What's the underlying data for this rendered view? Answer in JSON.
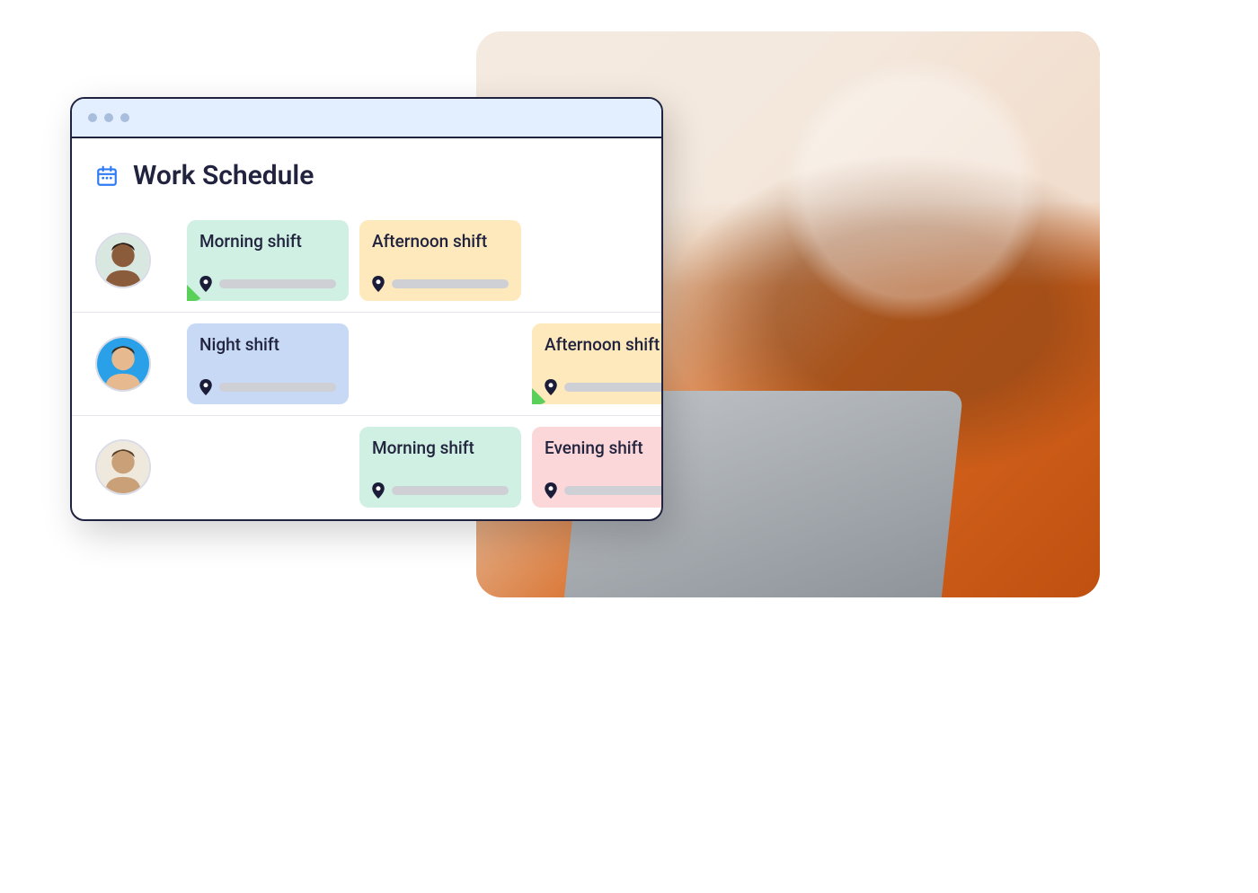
{
  "header": {
    "title": "Work Schedule"
  },
  "shift_types": {
    "morning": {
      "label": "Morning shift",
      "color": "teal"
    },
    "afternoon": {
      "label": "Afternoon shift",
      "color": "yellow"
    },
    "night": {
      "label": "Night shift",
      "color": "blue"
    },
    "evening": {
      "label": "Evening shift",
      "color": "pink"
    }
  },
  "rows": [
    {
      "employee": "employee-1",
      "cells": [
        {
          "shift": "morning",
          "tagged": true
        },
        {
          "shift": "afternoon",
          "tagged": false
        },
        null
      ]
    },
    {
      "employee": "employee-2",
      "cells": [
        {
          "shift": "night",
          "tagged": false
        },
        null,
        {
          "shift": "afternoon",
          "tagged": true
        }
      ]
    },
    {
      "employee": "employee-3",
      "cells": [
        null,
        {
          "shift": "morning",
          "tagged": false
        },
        {
          "shift": "evening",
          "tagged": false
        }
      ]
    }
  ]
}
